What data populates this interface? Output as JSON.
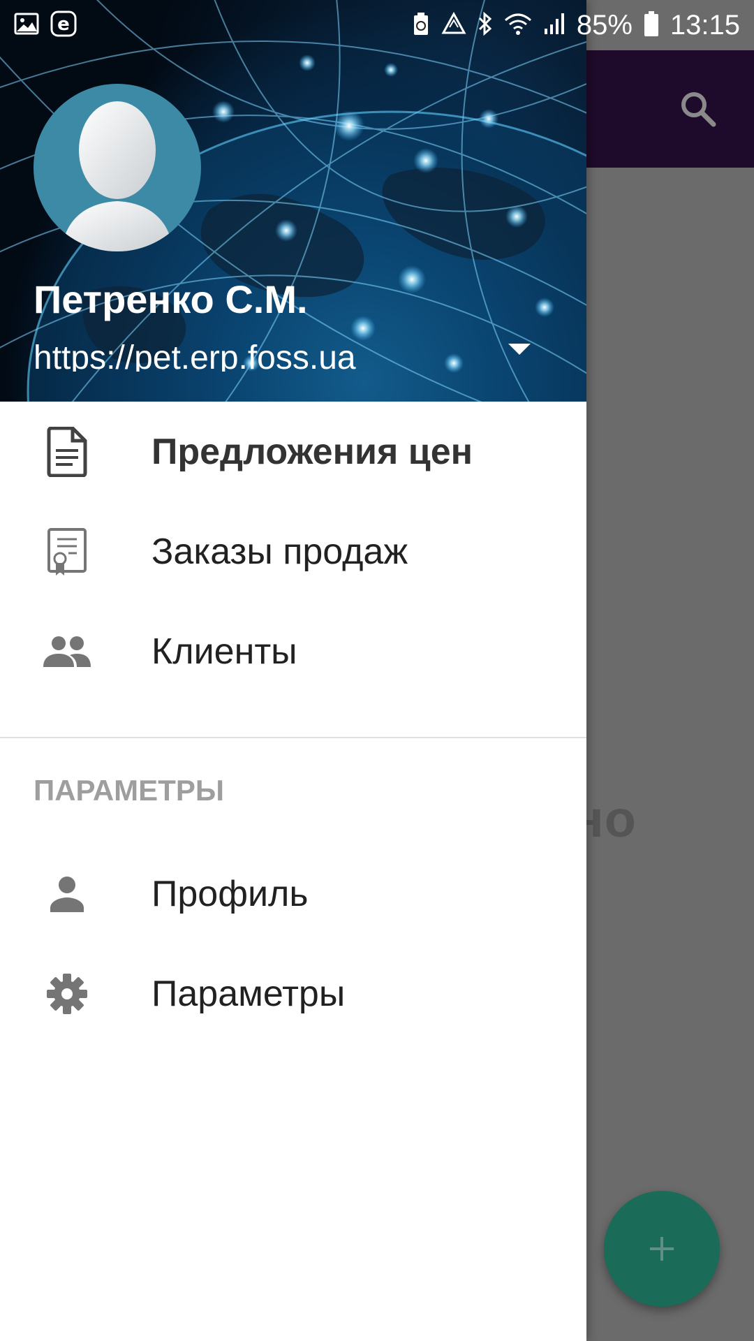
{
  "status_bar": {
    "battery_percent": "85%",
    "time": "13:15",
    "icons_left": [
      "gallery-icon",
      "e-icon"
    ],
    "icons_right": [
      "battery-saver-icon",
      "recycle-icon",
      "bluetooth-icon",
      "wifi-icon",
      "signal-icon",
      "battery-icon"
    ]
  },
  "background_app": {
    "appbar_color": "#1e0a2a",
    "partial_text": "но",
    "fab_color": "#1a6b58",
    "fab_label": "+"
  },
  "drawer": {
    "header": {
      "user_name": "Петренко С.М.",
      "user_url": "https://pet.erp.foss.ua"
    },
    "items": [
      {
        "label": "Предложения цен",
        "icon": "document-icon",
        "active": true
      },
      {
        "label": "Заказы продаж",
        "icon": "certificate-icon",
        "active": false
      },
      {
        "label": "Клиенты",
        "icon": "people-icon",
        "active": false
      }
    ],
    "section_title": "ПАРАМЕТРЫ",
    "section_items": [
      {
        "label": "Профиль",
        "icon": "person-icon"
      },
      {
        "label": "Параметры",
        "icon": "gear-icon"
      }
    ]
  }
}
